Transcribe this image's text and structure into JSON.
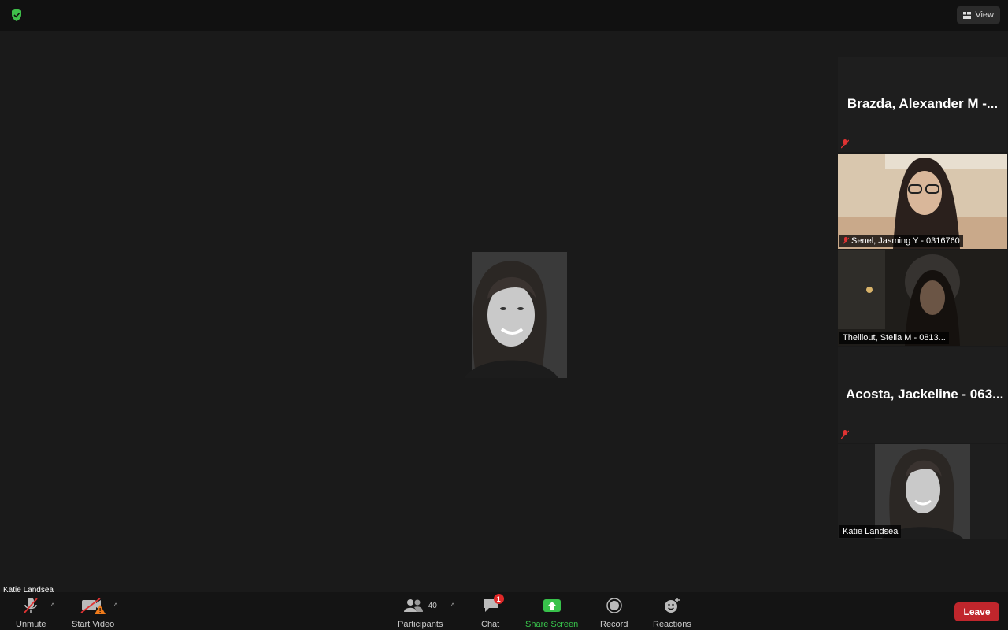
{
  "topbar": {
    "view_label": "View"
  },
  "gallery": [
    {
      "name": "Brazda, Alexander M -...",
      "type": "name",
      "muted": true
    },
    {
      "name": "Senel, Jasming Y - 0316760",
      "type": "video",
      "muted": true
    },
    {
      "name": "Theillout, Stella M - 0813...",
      "type": "video",
      "muted": false
    },
    {
      "name": "Acosta, Jackeline - 063...",
      "type": "name",
      "muted": true
    },
    {
      "name": "Katie Landsea",
      "type": "video",
      "muted": false,
      "active": true
    }
  ],
  "stage": {
    "speaker_name": "Katie Landsea"
  },
  "toolbar": {
    "unmute_label": "Unmute",
    "start_video_label": "Start Video",
    "participants_label": "Participants",
    "participants_count": "40",
    "chat_label": "Chat",
    "chat_badge": "1",
    "share_label": "Share Screen",
    "record_label": "Record",
    "reactions_label": "Reactions",
    "leave_label": "Leave"
  },
  "colors": {
    "share_green": "#38c24b",
    "leave_red": "#c0262c",
    "active_border": "#c7dd7a",
    "shield_green": "#3fbf4a"
  },
  "icons": {
    "security": "shield-icon",
    "view": "grid-icon",
    "mute": "mic-off-icon",
    "video": "video-off-icon",
    "participants": "people-icon",
    "chat": "chat-bubble-icon",
    "share": "share-arrow-icon",
    "record": "record-icon",
    "reactions": "smile-plus-icon"
  }
}
